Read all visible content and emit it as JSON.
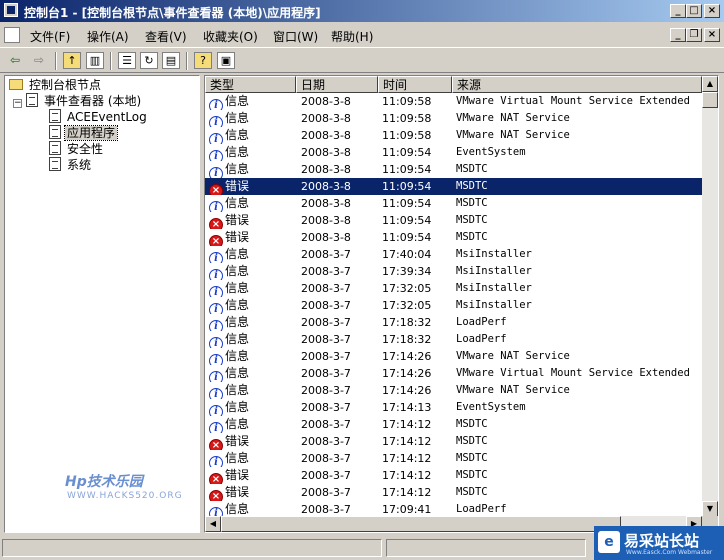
{
  "window": {
    "title": "控制台1 - [控制台根节点\\事件查看器 (本地)\\应用程序]"
  },
  "menubar": {
    "items": [
      "文件(F)",
      "操作(A)",
      "查看(V)",
      "收藏夹(O)",
      "窗口(W)",
      "帮助(H)"
    ]
  },
  "toolbar": {
    "buttons": [
      "back-arrow-icon",
      "forward-arrow-icon",
      "up-folder-icon",
      "show-hide-tree-icon",
      "properties-icon",
      "refresh-icon",
      "export-list-icon",
      "help-icon",
      "action-pane-icon"
    ]
  },
  "tree": {
    "root": "控制台根节点",
    "event_viewer": "事件查看器 (本地)",
    "logs": [
      "ACEEventLog",
      "应用程序",
      "安全性",
      "系统"
    ],
    "selected": "应用程序"
  },
  "list": {
    "columns": [
      "类型",
      "日期",
      "时间",
      "来源"
    ],
    "rows": [
      {
        "type": "信息",
        "level": "info",
        "date": "2008-3-8",
        "time": "11:09:58",
        "source": "VMware Virtual Mount Service Extended"
      },
      {
        "type": "信息",
        "level": "info",
        "date": "2008-3-8",
        "time": "11:09:58",
        "source": "VMware NAT Service"
      },
      {
        "type": "信息",
        "level": "info",
        "date": "2008-3-8",
        "time": "11:09:58",
        "source": "VMware NAT Service"
      },
      {
        "type": "信息",
        "level": "info",
        "date": "2008-3-8",
        "time": "11:09:54",
        "source": "EventSystem"
      },
      {
        "type": "信息",
        "level": "info",
        "date": "2008-3-8",
        "time": "11:09:54",
        "source": "MSDTC"
      },
      {
        "type": "错误",
        "level": "error",
        "date": "2008-3-8",
        "time": "11:09:54",
        "source": "MSDTC",
        "selected": true
      },
      {
        "type": "信息",
        "level": "info",
        "date": "2008-3-8",
        "time": "11:09:54",
        "source": "MSDTC"
      },
      {
        "type": "错误",
        "level": "error",
        "date": "2008-3-8",
        "time": "11:09:54",
        "source": "MSDTC"
      },
      {
        "type": "错误",
        "level": "error",
        "date": "2008-3-8",
        "time": "11:09:54",
        "source": "MSDTC"
      },
      {
        "type": "信息",
        "level": "info",
        "date": "2008-3-7",
        "time": "17:40:04",
        "source": "MsiInstaller"
      },
      {
        "type": "信息",
        "level": "info",
        "date": "2008-3-7",
        "time": "17:39:34",
        "source": "MsiInstaller"
      },
      {
        "type": "信息",
        "level": "info",
        "date": "2008-3-7",
        "time": "17:32:05",
        "source": "MsiInstaller"
      },
      {
        "type": "信息",
        "level": "info",
        "date": "2008-3-7",
        "time": "17:32:05",
        "source": "MsiInstaller"
      },
      {
        "type": "信息",
        "level": "info",
        "date": "2008-3-7",
        "time": "17:18:32",
        "source": "LoadPerf"
      },
      {
        "type": "信息",
        "level": "info",
        "date": "2008-3-7",
        "time": "17:18:32",
        "source": "LoadPerf"
      },
      {
        "type": "信息",
        "level": "info",
        "date": "2008-3-7",
        "time": "17:14:26",
        "source": "VMware NAT Service"
      },
      {
        "type": "信息",
        "level": "info",
        "date": "2008-3-7",
        "time": "17:14:26",
        "source": "VMware Virtual Mount Service Extended"
      },
      {
        "type": "信息",
        "level": "info",
        "date": "2008-3-7",
        "time": "17:14:26",
        "source": "VMware NAT Service"
      },
      {
        "type": "信息",
        "level": "info",
        "date": "2008-3-7",
        "time": "17:14:13",
        "source": "EventSystem"
      },
      {
        "type": "信息",
        "level": "info",
        "date": "2008-3-7",
        "time": "17:14:12",
        "source": "MSDTC"
      },
      {
        "type": "错误",
        "level": "error",
        "date": "2008-3-7",
        "time": "17:14:12",
        "source": "MSDTC"
      },
      {
        "type": "信息",
        "level": "info",
        "date": "2008-3-7",
        "time": "17:14:12",
        "source": "MSDTC"
      },
      {
        "type": "错误",
        "level": "error",
        "date": "2008-3-7",
        "time": "17:14:12",
        "source": "MSDTC"
      },
      {
        "type": "错误",
        "level": "error",
        "date": "2008-3-7",
        "time": "17:14:12",
        "source": "MSDTC"
      },
      {
        "type": "信息",
        "level": "info",
        "date": "2008-3-7",
        "time": "17:09:41",
        "source": "LoadPerf"
      }
    ]
  },
  "watermark": {
    "line1": "Hp技术乐园",
    "line2": "WWW.HACKS520.ORG"
  },
  "corner_logo": {
    "text": "易采站长站",
    "sub": "Www.Easck.Com Webmaster"
  },
  "colors": {
    "title_start": "#0a246a",
    "title_end": "#a6caf0",
    "selection": "#0a246a",
    "face": "#d4d0c8",
    "error": "#d81818",
    "info": "#1a3cc8"
  }
}
